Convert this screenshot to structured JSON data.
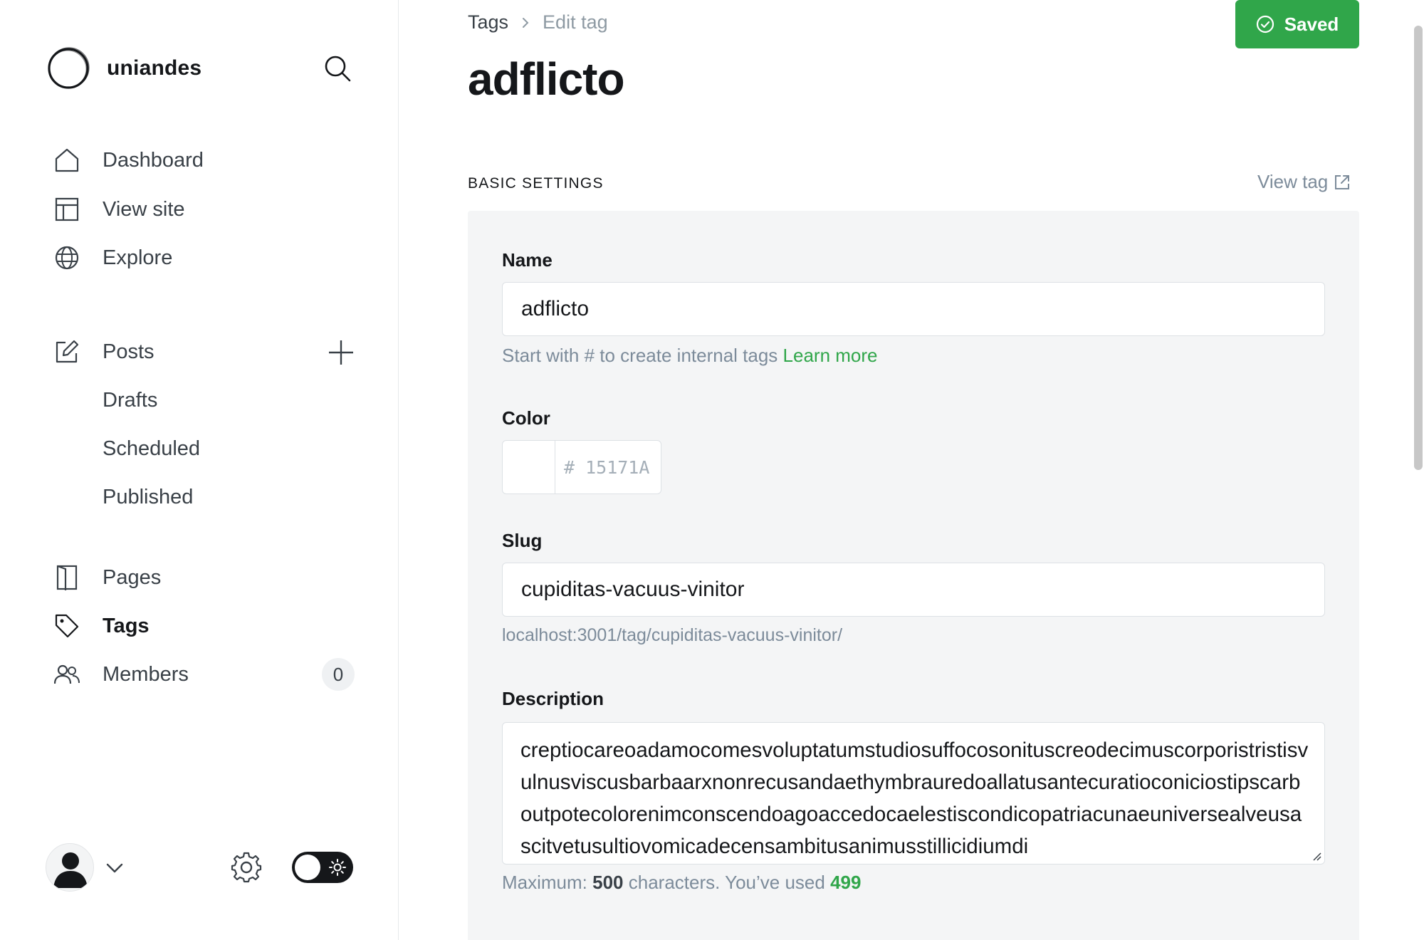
{
  "sidebar": {
    "brand_name": "uniandes",
    "nav": [
      {
        "label": "Dashboard",
        "icon": "home-icon"
      },
      {
        "label": "View site",
        "icon": "layout-icon"
      },
      {
        "label": "Explore",
        "icon": "globe-icon"
      }
    ],
    "posts": {
      "label": "Posts",
      "icon": "edit-icon",
      "sub": [
        "Drafts",
        "Scheduled",
        "Published"
      ]
    },
    "pages": {
      "label": "Pages",
      "icon": "page-icon"
    },
    "tags": {
      "label": "Tags",
      "icon": "tag-icon",
      "active": true
    },
    "members": {
      "label": "Members",
      "icon": "members-icon",
      "count": "0"
    }
  },
  "header": {
    "breadcrumb_parent": "Tags",
    "breadcrumb_current": "Edit tag",
    "saved_label": "Saved",
    "title": "adflicto"
  },
  "section": {
    "title": "BASIC SETTINGS",
    "view_tag_label": "View tag"
  },
  "form": {
    "name_label": "Name",
    "name_value": "adflicto",
    "name_hint": "Start with # to create internal tags",
    "name_hint_link": "Learn more",
    "color_label": "Color",
    "color_placeholder": "# 15171A",
    "slug_label": "Slug",
    "slug_value": "cupiditas-vacuus-vinitor",
    "slug_url": "localhost:3001/tag/cupiditas-vacuus-vinitor/",
    "description_label": "Description",
    "description_value": "creptiocareoadamocomesvoluptatumstudiosuffocosonituscreodecimuscorporistristisvulnusviscusbarbaarxnonrecusandaethymbrauredoallatusantecuratioconiciostipscarboutpotecolorenimconscendoagoaccedocaelestiscondicopatriacunaeuniversealveusascitvetusultiovomicadecensambitusanimusstillicidiumdi",
    "desc_hint_prefix": "Maximum:",
    "desc_max": "500",
    "desc_hint_mid": "characters. You’ve used",
    "desc_used": "499"
  },
  "colors": {
    "accent": "#30a64a",
    "text": "#15171a",
    "muted": "#7c8b9a"
  }
}
